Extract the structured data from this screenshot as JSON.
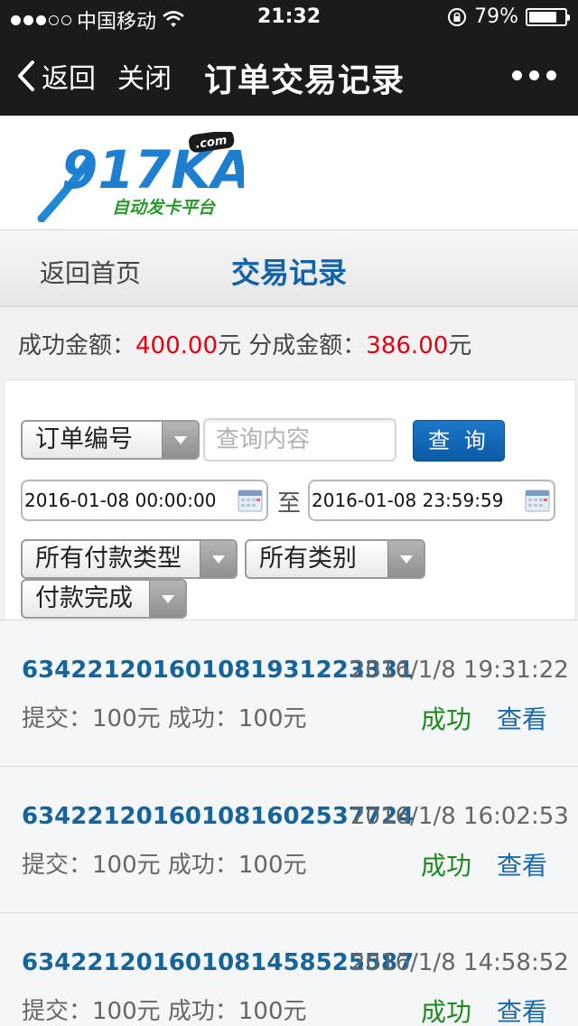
{
  "status_bar": {
    "carrier": "中国移动",
    "time": "21:32",
    "battery_percent": "79%",
    "battery_level": 0.79
  },
  "nav": {
    "back_label": "返回",
    "close_label": "关闭",
    "title": "订单交易记录"
  },
  "logo": {
    "brand": "917KA",
    "tld": ".com",
    "tagline": "自动发卡平台"
  },
  "tabs": {
    "home_label": "返回首页",
    "records_label": "交易记录"
  },
  "summary": {
    "success_label": "成功金额：",
    "success_amount": "400.00",
    "split_label": "分成金额：",
    "split_amount": "386.00",
    "unit": "元"
  },
  "filter": {
    "field_select": "订单编号",
    "query_placeholder": "查询内容",
    "query_button": "查 询",
    "date_from": "2016-01-08 00:00:00",
    "to_label": "至",
    "date_to": "2016-01-08 23:59:59",
    "payment_type": "所有付款类型",
    "category": "所有类别",
    "pay_status": "付款完成"
  },
  "records": [
    {
      "id": "634221201601081931223331",
      "time": "2016/1/8 19:31:22",
      "amounts": "提交：100元 成功：100元",
      "status": "成功",
      "view": "查看"
    },
    {
      "id": "634221201601081602537724",
      "time": "2016/1/8 16:02:53",
      "amounts": "提交：100元 成功：100元",
      "status": "成功",
      "view": "查看"
    },
    {
      "id": "634221201601081458525587",
      "time": "2016/1/8 14:58:52",
      "amounts": "提交：100元 成功：100元",
      "status": "成功",
      "view": "查看"
    }
  ],
  "colors": {
    "nav_bg": "#1b1b1b",
    "accent_blue": "#1162a6",
    "amount_red": "#e60012",
    "success_green": "#1c8a1c"
  },
  "icons": {
    "back": "chevron-left-icon",
    "more": "more-dots-icon",
    "wifi": "wifi-icon",
    "rotation_lock": "rotation-lock-icon",
    "battery": "battery-icon",
    "calendar": "calendar-icon",
    "dropdown": "dropdown-arrow-icon"
  }
}
